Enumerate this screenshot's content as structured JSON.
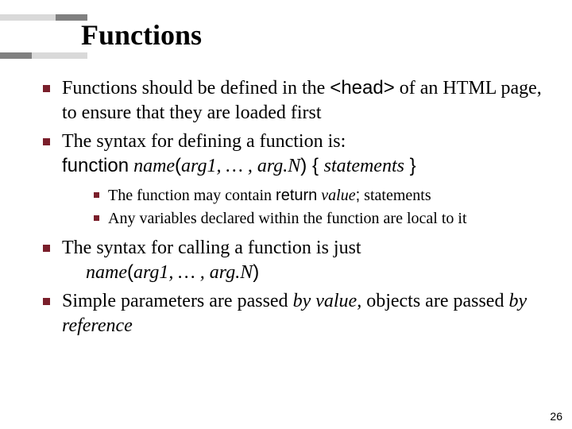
{
  "title": "Functions",
  "bullets": [
    {
      "pre": "Functions should be defined in the ",
      "code1": "<head>",
      "post": " of an HTML page, to ensure that they are loaded first"
    },
    {
      "text": "The syntax for defining a function is:",
      "syntax": {
        "kw": "function",
        "name": " name",
        "args": "arg1, … , arg.N",
        "stmts": "statements"
      },
      "sub": [
        {
          "pre": "The function may contain ",
          "kw": "return",
          "val": " value",
          "semi": ";",
          "post": "  statements"
        },
        {
          "text": "Any variables declared within the function are local to it"
        }
      ]
    },
    {
      "text": "The syntax for calling a function is just",
      "call": {
        "name": "name",
        "args": "arg1, … , arg.N"
      }
    },
    {
      "pre": "Simple parameters are passed ",
      "em1": "by value,",
      "mid": " objects are passed ",
      "em2": "by reference"
    }
  ],
  "pageNumber": "26"
}
